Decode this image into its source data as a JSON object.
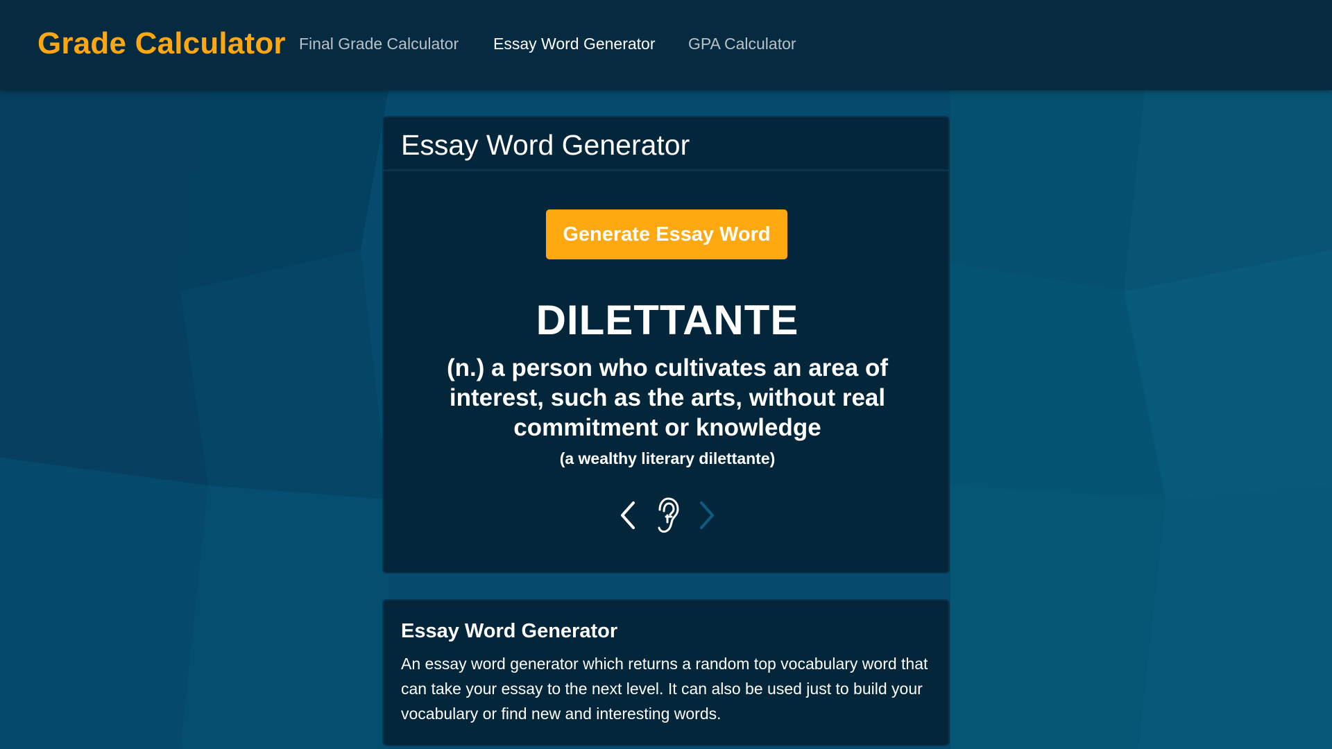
{
  "colors": {
    "accent": "#ffa80f",
    "navbar": "#062a3f",
    "card": "#04263a",
    "background": "#064a6e"
  },
  "navbar": {
    "brand": "Grade Calculator",
    "links": [
      {
        "label": "Final Grade Calculator",
        "active": false
      },
      {
        "label": "Essay Word Generator",
        "active": true
      },
      {
        "label": "GPA Calculator",
        "active": false
      }
    ]
  },
  "generator": {
    "title": "Essay Word Generator",
    "button_label": "Generate Essay Word",
    "word": "DILETTANTE",
    "definition": "(n.) a person who cultivates an area of interest, such as the arts, without real commitment or knowledge",
    "example": "(a wealthy literary dilettante)",
    "controls": {
      "prev_icon": "chevron-left-icon",
      "listen_icon": "ear-icon",
      "next_icon": "chevron-right-icon",
      "next_enabled": false
    }
  },
  "info": {
    "title": "Essay Word Generator",
    "text": "An essay word generator which returns a random top vocabulary word that can take your essay to the next level. It can also be used just to build your vocabulary or find new and interesting words."
  }
}
